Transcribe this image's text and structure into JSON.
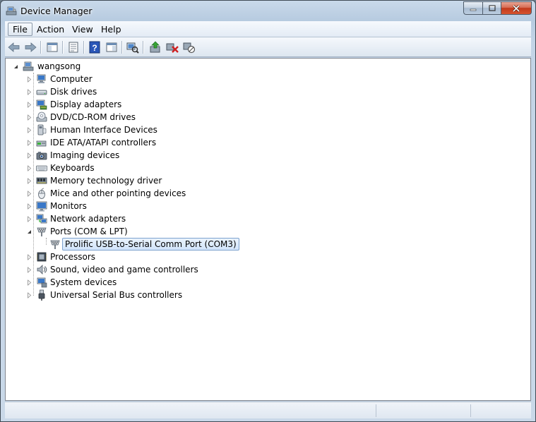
{
  "window": {
    "title": "Device Manager"
  },
  "menu": [
    "File",
    "Action",
    "View",
    "Help"
  ],
  "toolbar": {
    "buttons": [
      {
        "name": "back-button",
        "icon": "back-arrow-icon"
      },
      {
        "name": "forward-button",
        "icon": "forward-arrow-icon"
      },
      {
        "name": "show-hide-console-tree-button",
        "icon": "console-tree-icon"
      },
      {
        "name": "properties-button",
        "icon": "properties-icon"
      },
      {
        "name": "help-button",
        "icon": "help-icon"
      },
      {
        "name": "action-pane-button",
        "icon": "action-pane-icon"
      },
      {
        "name": "scan-hardware-button",
        "icon": "scan-hardware-icon"
      },
      {
        "name": "update-driver-button",
        "icon": "update-driver-icon"
      },
      {
        "name": "uninstall-button",
        "icon": "uninstall-icon"
      },
      {
        "name": "disable-button",
        "icon": "disable-icon"
      }
    ]
  },
  "tree": {
    "root": "wangsong",
    "categories": [
      {
        "label": "Computer",
        "icon": "computer-icon",
        "expanded": false
      },
      {
        "label": "Disk drives",
        "icon": "disk-drive-icon",
        "expanded": false
      },
      {
        "label": "Display adapters",
        "icon": "display-adapter-icon",
        "expanded": false
      },
      {
        "label": "DVD/CD-ROM drives",
        "icon": "dvd-drive-icon",
        "expanded": false
      },
      {
        "label": "Human Interface Devices",
        "icon": "hid-icon",
        "expanded": false
      },
      {
        "label": "IDE ATA/ATAPI controllers",
        "icon": "ide-controller-icon",
        "expanded": false
      },
      {
        "label": "Imaging devices",
        "icon": "imaging-device-icon",
        "expanded": false
      },
      {
        "label": "Keyboards",
        "icon": "keyboard-icon",
        "expanded": false
      },
      {
        "label": "Memory technology driver",
        "icon": "memory-icon",
        "expanded": false
      },
      {
        "label": "Mice and other pointing devices",
        "icon": "mouse-icon",
        "expanded": false
      },
      {
        "label": "Monitors",
        "icon": "monitor-icon",
        "expanded": false
      },
      {
        "label": "Network adapters",
        "icon": "network-adapter-icon",
        "expanded": false
      },
      {
        "label": "Ports (COM & LPT)",
        "icon": "port-icon",
        "expanded": true,
        "children": [
          {
            "label": "Prolific USB-to-Serial Comm Port (COM3)",
            "icon": "port-icon",
            "selected": true
          }
        ]
      },
      {
        "label": "Processors",
        "icon": "processor-icon",
        "expanded": false
      },
      {
        "label": "Sound, video and game controllers",
        "icon": "sound-icon",
        "expanded": false
      },
      {
        "label": "System devices",
        "icon": "system-device-icon",
        "expanded": false
      },
      {
        "label": "Universal Serial Bus controllers",
        "icon": "usb-icon",
        "expanded": false
      }
    ]
  },
  "colors": {
    "selection_border": "#7da2ce",
    "selection_fill": "#d1e4fb",
    "close_button": "#c23a1c"
  }
}
